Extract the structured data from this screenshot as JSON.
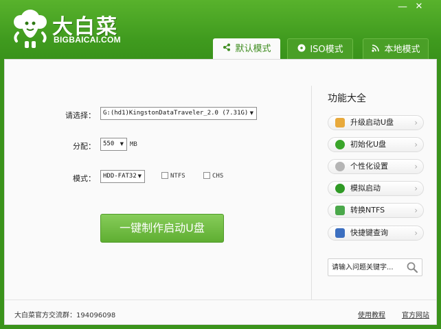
{
  "brand": {
    "title": "大白菜",
    "subtitle": "BIGBAICAI.COM"
  },
  "window_controls": {
    "minimize": "—",
    "close": "✕"
  },
  "tabs": [
    {
      "label": "默认模式",
      "icon": "share-icon",
      "active": true
    },
    {
      "label": "ISO模式",
      "icon": "disc-icon",
      "active": false
    },
    {
      "label": "本地模式",
      "icon": "rss-icon",
      "active": false
    }
  ],
  "form": {
    "select_label": "请选择：",
    "drive_value": "G:(hd1)KingstonDataTraveler_2.0 (7.31G)",
    "partition_label": "分配：",
    "partition_value": "550",
    "partition_unit": "MB",
    "mode_label": "模式：",
    "mode_value": "HDD-FAT32",
    "ntfs_label": "NTFS",
    "ntfs_checked": false,
    "chs_label": "CHS",
    "chs_checked": false,
    "make_button": "一键制作启动U盘"
  },
  "functions": {
    "title": "功能大全",
    "items": [
      {
        "label": "升级启动U盘",
        "icon": "upgrade-icon",
        "color": "#e8a93b"
      },
      {
        "label": "初始化U盘",
        "icon": "init-icon",
        "color": "#3aa52a"
      },
      {
        "label": "个性化设置",
        "icon": "settings-gear-icon",
        "color": "#9a9a9a"
      },
      {
        "label": "模拟启动",
        "icon": "simulate-icon",
        "color": "#2f9a25"
      },
      {
        "label": "转换NTFS",
        "icon": "convert-icon",
        "color": "#4aa84a"
      },
      {
        "label": "快捷键查询",
        "icon": "keyboard-book-icon",
        "color": "#3c6fc0"
      }
    ],
    "search_placeholder": "请输入问题关键字..."
  },
  "footer": {
    "group_text": "大白菜官方交流群：194096098",
    "guide_link": "使用教程",
    "site_link": "官方网站"
  },
  "colors": {
    "brand_green": "#3f9a1e",
    "tab_text_active": "#3f8d20",
    "button_green": "#6ab83e"
  }
}
